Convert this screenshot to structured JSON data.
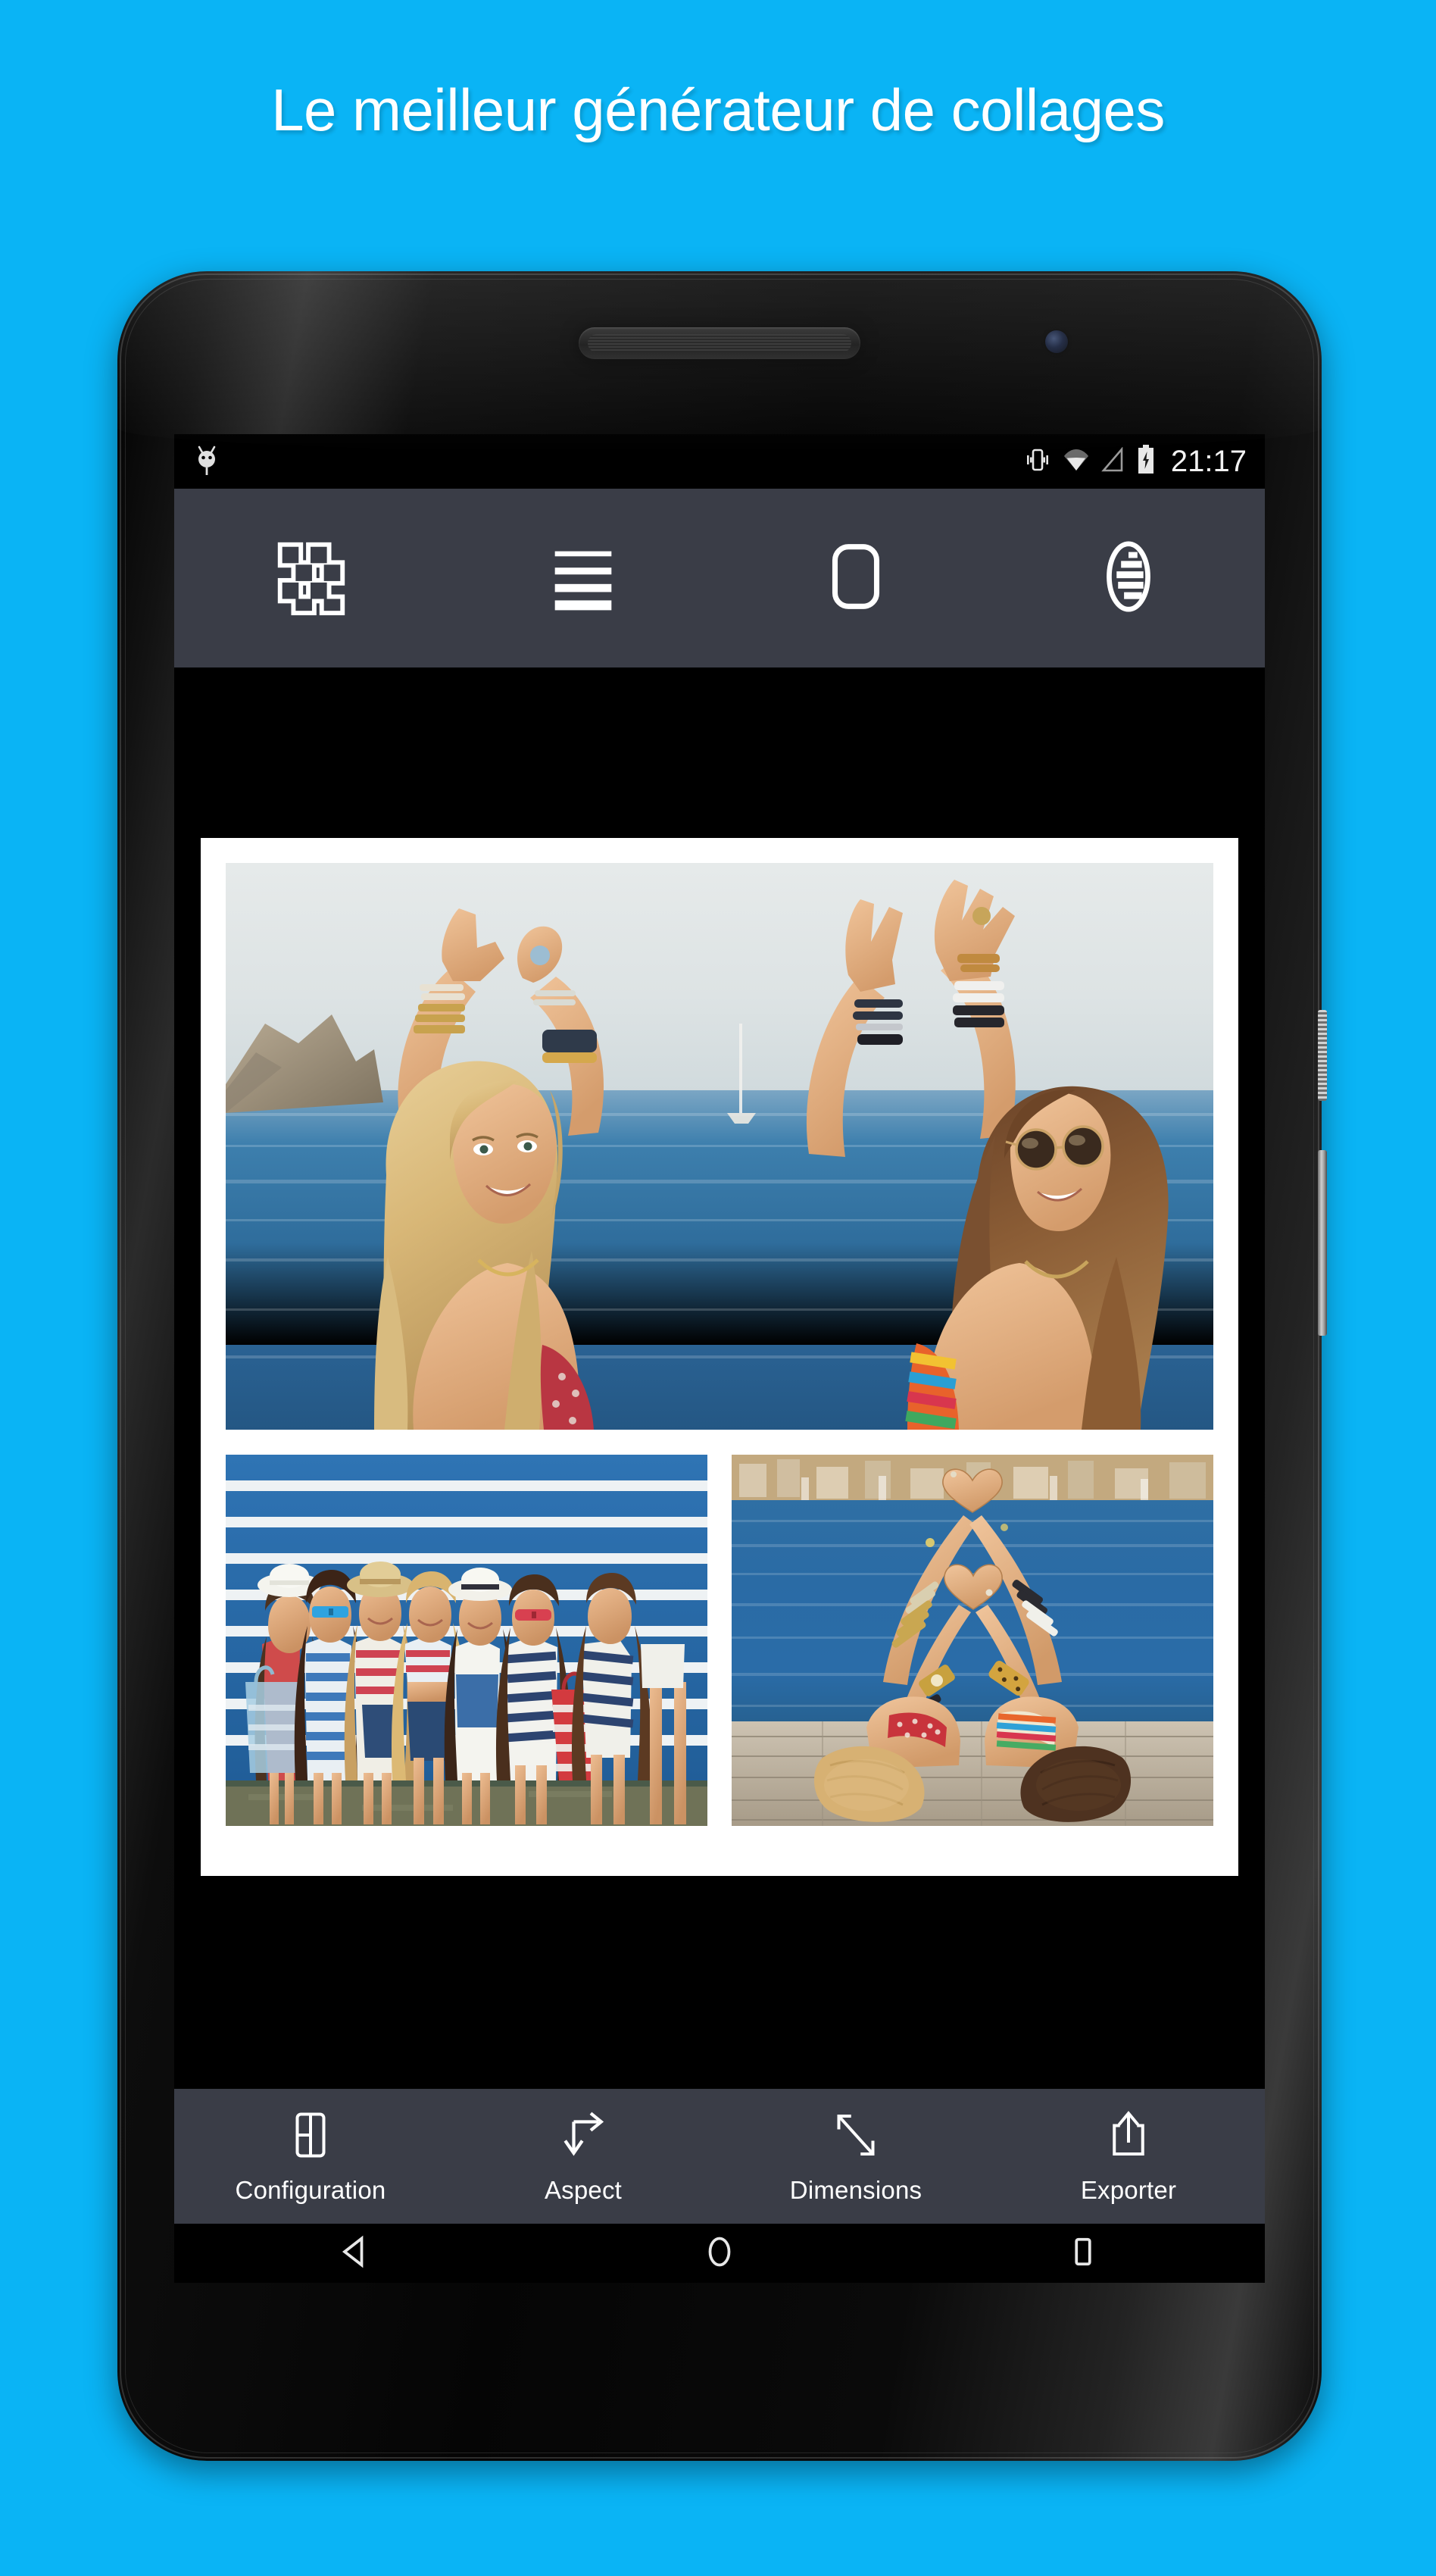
{
  "page": {
    "headline": "Le meilleur générateur de collages",
    "background_color": "#0ab4f5",
    "headline_color": "#ffffff"
  },
  "device": {
    "type": "android-phone",
    "body_color": "#0a0a0a",
    "screen_background": "#000000"
  },
  "status_bar": {
    "time": "21:17",
    "background_color": "#000000",
    "icons": [
      {
        "name": "android-notification-icon",
        "position": "left"
      },
      {
        "name": "vibrate-icon",
        "position": "right"
      },
      {
        "name": "wifi-icon",
        "position": "right"
      },
      {
        "name": "signal-icon",
        "position": "right"
      },
      {
        "name": "battery-charging-icon",
        "position": "right"
      }
    ]
  },
  "toolbar": {
    "background_color": "#3a3d47",
    "icon_color": "#ffffff",
    "buttons": [
      {
        "name": "grid-layout-icon",
        "label": "Grille"
      },
      {
        "name": "lines-spacing-icon",
        "label": "Lignes"
      },
      {
        "name": "rounded-corners-icon",
        "label": "Coins arrondis"
      },
      {
        "name": "shadow-contrast-icon",
        "label": "Ombre"
      }
    ]
  },
  "collage": {
    "frame_color": "#ffffff",
    "canvas_background": "#000000",
    "layout": "1 grande photo en haut, 2 photos en bas",
    "photos": [
      {
        "name": "photo-two-girls-sea",
        "position": "top",
        "description": "Deux filles sur la plage, bras levés, mer en arrière-plan"
      },
      {
        "name": "photo-group-girls-wall",
        "position": "bottom-left",
        "description": "Groupe de filles devant un mur à rayures bleues"
      },
      {
        "name": "photo-heart-hands",
        "position": "bottom-right",
        "description": "Deux filles allongées formant des cœurs avec les mains"
      }
    ]
  },
  "action_bar": {
    "background_color": "#3a3d47",
    "label_color": "#ffffff",
    "items": [
      {
        "label": "Configuration",
        "icon": "layout-grid-icon"
      },
      {
        "label": "Aspect",
        "icon": "aspect-ratio-arrow-icon"
      },
      {
        "label": "Dimensions",
        "icon": "resize-diagonal-arrow-icon"
      },
      {
        "label": "Exporter",
        "icon": "share-export-icon"
      }
    ]
  },
  "navigation_bar": {
    "background_color": "#000000",
    "buttons": [
      {
        "name": "back-button",
        "icon": "back-triangle-icon"
      },
      {
        "name": "home-button",
        "icon": "home-circle-icon"
      },
      {
        "name": "recents-button",
        "icon": "recents-square-icon"
      }
    ]
  }
}
